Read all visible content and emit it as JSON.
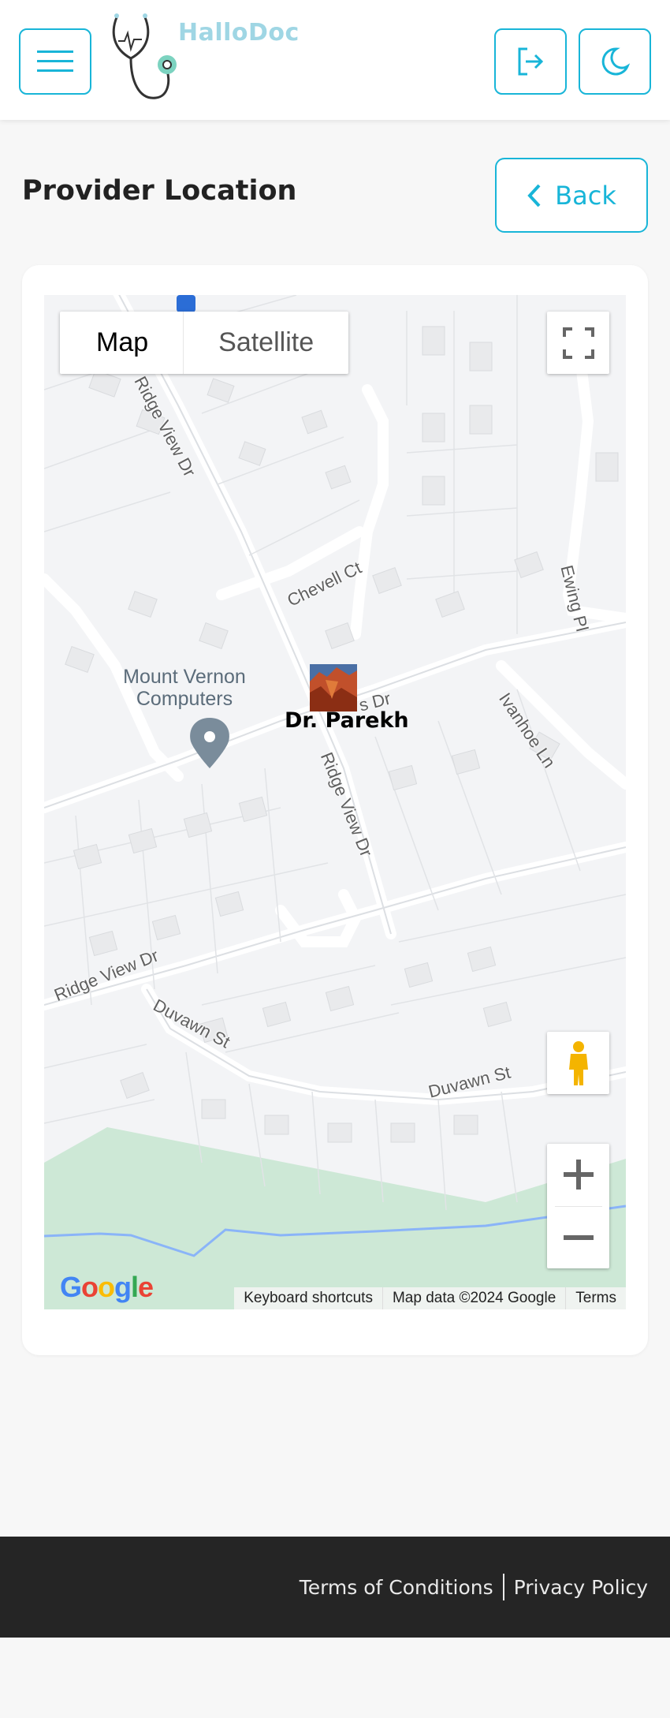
{
  "brand": {
    "name": "HalloDoc"
  },
  "header": {
    "menu_icon": "hamburger-icon",
    "logout_icon": "logout-icon",
    "theme_icon": "moon-icon"
  },
  "page": {
    "title": "Provider Location",
    "back_label": "Back"
  },
  "map": {
    "type_map": "Map",
    "type_satellite": "Satellite",
    "marker_label": "Dr. Parekh",
    "poi_name": "Mount Vernon Computers",
    "streets": [
      "Chevell Ct",
      "Ewing Pl",
      "Ivanhoe Ln",
      "Ridge View Dr",
      "Duvawn St",
      "Ridge View Dr",
      "Duvawn St",
      "Ridge View Dr",
      "s Dr"
    ],
    "google_logo": "Google",
    "attribution": [
      "Keyboard shortcuts",
      "Map data ©2024 Google",
      "Terms"
    ]
  },
  "footer": {
    "terms": "Terms of Conditions",
    "privacy": "Privacy Policy"
  },
  "colors": {
    "accent": "#18b5d8",
    "footer_bg": "#252525",
    "map_green": "#cde8d6",
    "water": "#8ab4f8"
  }
}
